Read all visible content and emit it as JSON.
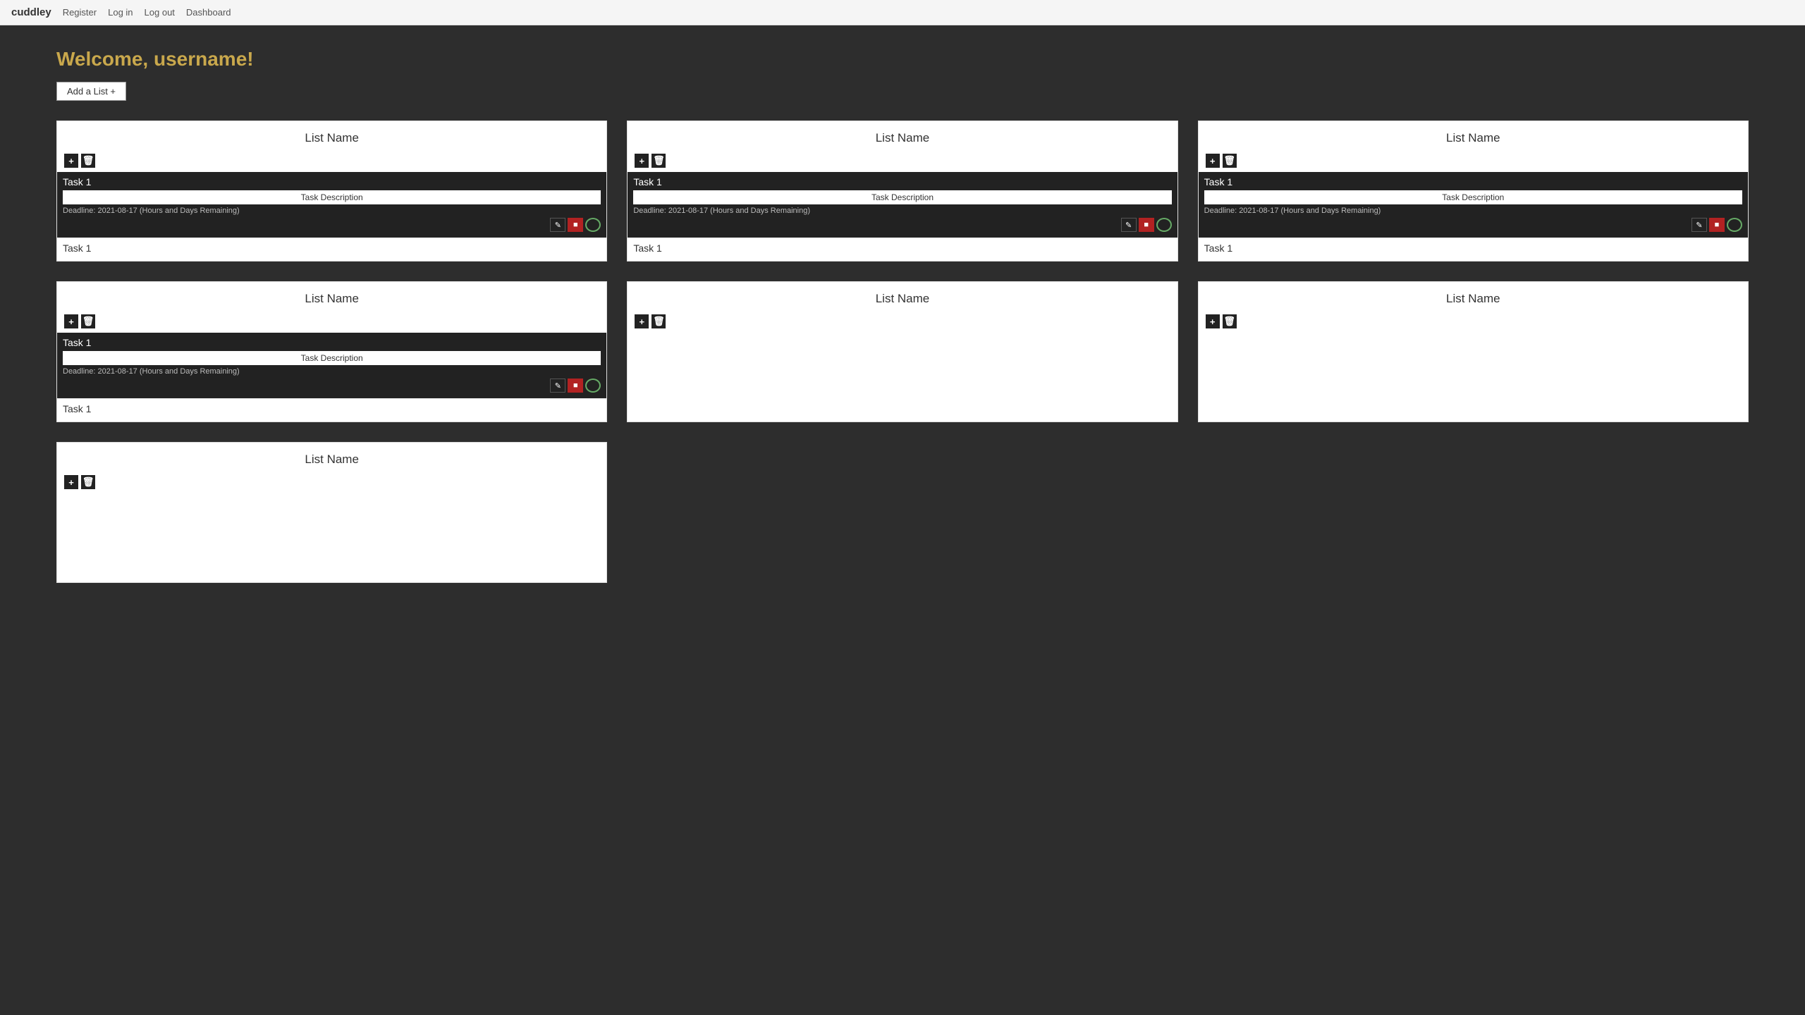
{
  "navbar": {
    "brand": "cuddley",
    "links": [
      "Register",
      "Log in",
      "Log out",
      "Dashboard"
    ]
  },
  "welcome": {
    "title": "Welcome, username!",
    "add_list_label": "Add a List +"
  },
  "lists": [
    {
      "id": "list-1",
      "name": "List Name",
      "has_tasks": true,
      "tasks": [
        {
          "name": "Task 1",
          "description": "Task Description",
          "deadline": "Deadline: 2021-08-17 (Hours and Days Remaining)"
        }
      ],
      "below_task": "Task 1"
    },
    {
      "id": "list-2",
      "name": "List Name",
      "has_tasks": true,
      "tasks": [
        {
          "name": "Task 1",
          "description": "Task Description",
          "deadline": "Deadline: 2021-08-17 (Hours and Days Remaining)"
        }
      ],
      "below_task": "Task 1"
    },
    {
      "id": "list-3",
      "name": "List Name",
      "has_tasks": true,
      "tasks": [
        {
          "name": "Task 1",
          "description": "Task Description",
          "deadline": "Deadline: 2021-08-17 (Hours and Days Remaining)"
        }
      ],
      "below_task": "Task 1"
    },
    {
      "id": "list-4",
      "name": "List Name",
      "has_tasks": true,
      "tasks": [
        {
          "name": "Task 1",
          "description": "Task Description",
          "deadline": "Deadline: 2021-08-17 (Hours and Days Remaining)"
        }
      ],
      "below_task": "Task 1"
    },
    {
      "id": "list-5",
      "name": "List Name",
      "has_tasks": false,
      "tasks": []
    },
    {
      "id": "list-6",
      "name": "List Name",
      "has_tasks": false,
      "tasks": []
    },
    {
      "id": "list-7",
      "name": "List Name",
      "has_tasks": false,
      "tasks": []
    }
  ],
  "icons": {
    "plus": "+",
    "trash": "🗑",
    "edit": "✎",
    "delete_red": "■",
    "circle": "○"
  }
}
